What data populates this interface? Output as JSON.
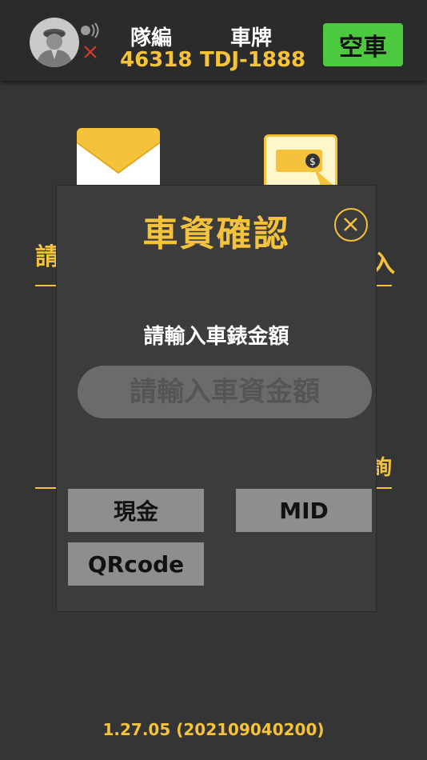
{
  "header": {
    "team_label": "隊編",
    "team_value": "46318",
    "plate_label": "車牌",
    "plate_value": "TDJ-1888",
    "status_button": "空車"
  },
  "dialog": {
    "title": "車資確認",
    "prompt": "請輸入車錶金額",
    "fare_input": {
      "value": "",
      "placeholder": "請輸入車資金額"
    },
    "buttons": {
      "cash": "現金",
      "mid": "MID",
      "qrcode": "QRcode"
    }
  },
  "background": {
    "left_partial_text": "請",
    "right_partial_text_1": "入",
    "right_partial_text_2": "詢"
  },
  "footer": {
    "version": "1.27.05 (202109040200)"
  },
  "colors": {
    "accent": "#f5c33b",
    "status_green": "#4cc93e",
    "background": "#353535",
    "dialog": "#3c3c3c",
    "button_gray": "#8e8e8e"
  }
}
